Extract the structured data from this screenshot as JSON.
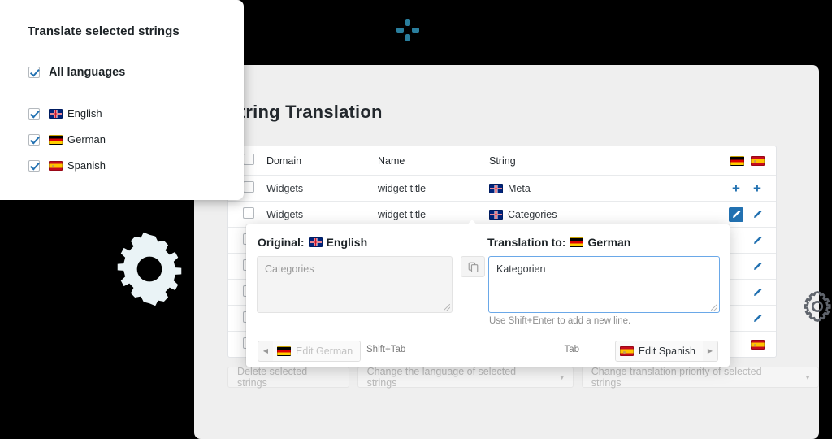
{
  "left_card": {
    "title": "Translate selected strings",
    "all_languages": {
      "label": "All languages",
      "checked": true
    },
    "languages": [
      {
        "label": "English",
        "flag": "gb-flag-icon",
        "checked": true
      },
      {
        "label": "German",
        "flag": "de-flag-icon",
        "checked": true
      },
      {
        "label": "Spanish",
        "flag": "es-flag-icon",
        "checked": true
      }
    ]
  },
  "spinner": {
    "icon": "loading-spinner-icon",
    "color": "#2a7f9e"
  },
  "decor": {
    "gear_left": "gear-icon",
    "gear_right": "gear-icon",
    "gear_left_color": "#eaf3f6",
    "gear_right_color": "#6b6f76"
  },
  "main": {
    "title": "String Translation",
    "table": {
      "columns": [
        "Domain",
        "Name",
        "String"
      ],
      "action_flags": [
        "de-flag-icon",
        "es-flag-icon"
      ],
      "rows": [
        {
          "domain": "Widgets",
          "name": "widget title",
          "string": "Meta",
          "string_flag": "gb-flag-icon",
          "actions": [
            "plus-icon",
            "plus-icon"
          ]
        },
        {
          "domain": "Widgets",
          "name": "widget title",
          "string": "Categories",
          "string_flag": "gb-flag-icon",
          "actions": [
            "pencil-active-icon",
            "pencil-icon"
          ]
        }
      ],
      "obscured_row_count": 5
    }
  },
  "popup": {
    "original_label": "Original:",
    "original_language": "English",
    "original_flag": "gb-flag-icon",
    "original_value": "",
    "original_placeholder": "Categories",
    "copy_icon": "copy-icon",
    "translation_label": "Translation to:",
    "translation_language": "German",
    "translation_flag": "de-flag-icon",
    "translation_value": "Kategorien",
    "hint": "Use Shift+Enter to add a new line.",
    "prev_button": {
      "label": "Edit German",
      "flag": "de-flag-icon",
      "shortcut": "Shift+Tab",
      "arrow": "◀",
      "disabled": true
    },
    "next_button": {
      "label": "Edit Spanish",
      "flag": "es-flag-icon",
      "shortcut": "Tab",
      "arrow": "▶",
      "disabled": false
    }
  },
  "bulk_actions": {
    "delete_label": "Delete selected strings",
    "change_language_label": "Change the language of selected strings",
    "change_priority_label": "Change translation priority of selected strings",
    "caret": "▼"
  }
}
